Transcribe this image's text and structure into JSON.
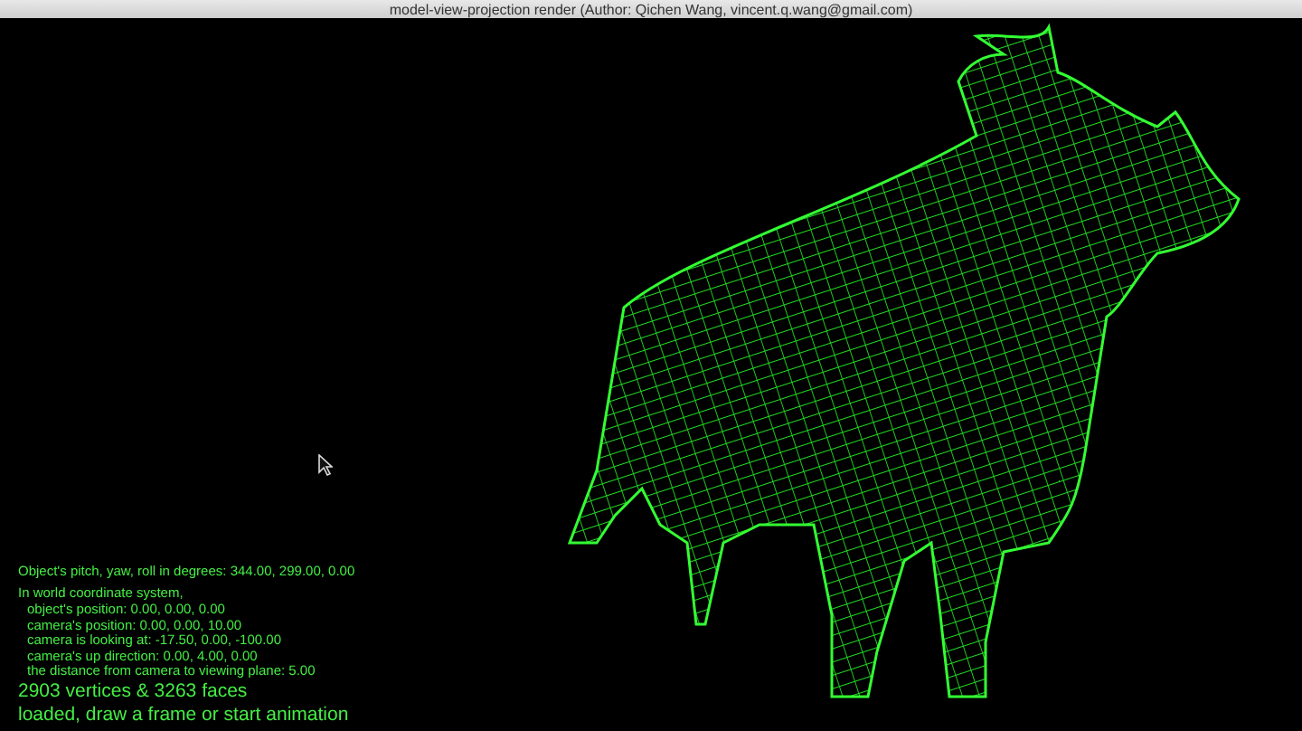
{
  "window": {
    "title": "model-view-projection render (Author: Qichen Wang, vincent.q.wang@gmail.com)"
  },
  "info": {
    "orientation": "Object's pitch, yaw, roll in degrees: 344.00, 299.00, 0.00",
    "heading": "In world coordinate system,",
    "lines": [
      "object's position: 0.00, 0.00, 0.00",
      "camera's position: 0.00, 0.00, 10.00",
      "camera is looking at: -17.50, 0.00, -100.00",
      "camera's up direction: 0.00, 4.00, 0.00",
      "the distance from camera to viewing plane: 5.00"
    ]
  },
  "status": [
    "2903 vertices & 3263 faces",
    "loaded, draw a frame or start animation"
  ]
}
